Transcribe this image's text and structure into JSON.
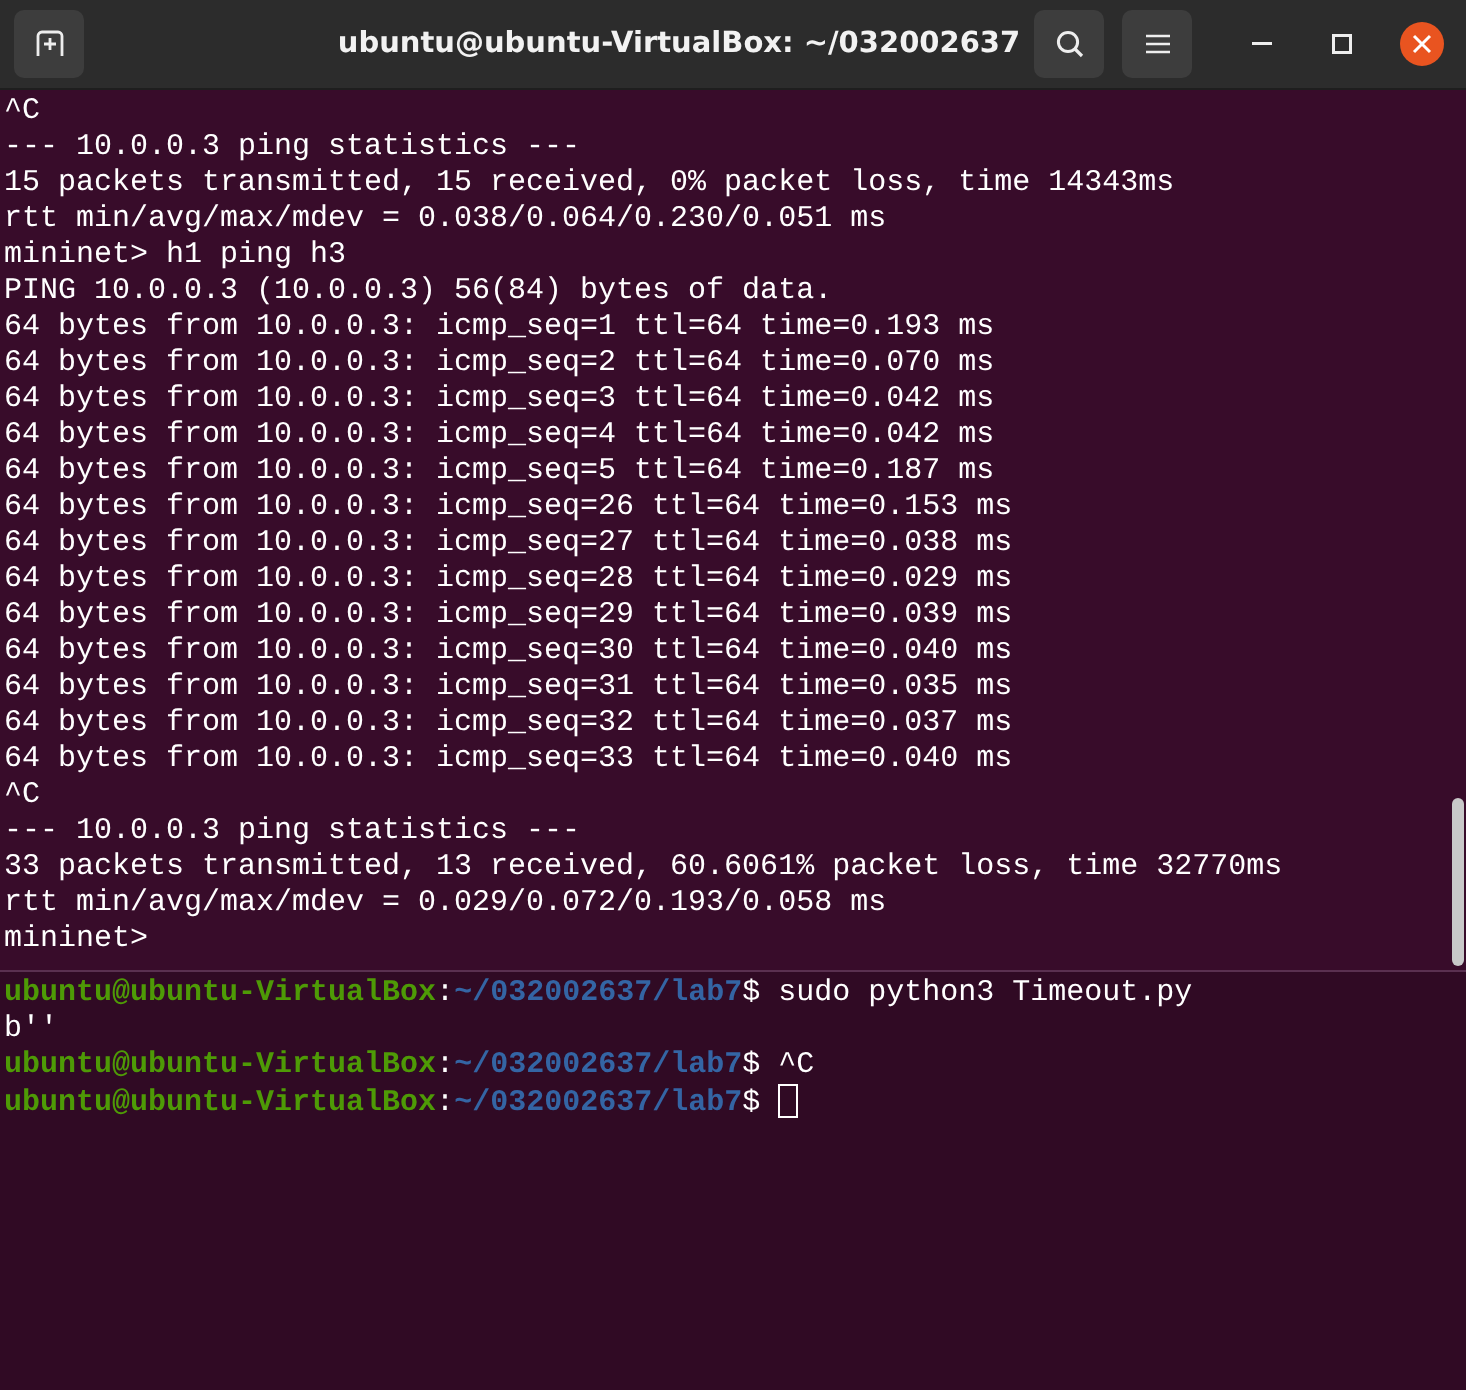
{
  "window": {
    "title": "ubuntu@ubuntu-VirtualBox: ~/032002637"
  },
  "top_pane": {
    "lines": [
      "^C",
      "--- 10.0.0.3 ping statistics ---",
      "15 packets transmitted, 15 received, 0% packet loss, time 14343ms",
      "rtt min/avg/max/mdev = 0.038/0.064/0.230/0.051 ms",
      "mininet> h1 ping h3",
      "PING 10.0.0.3 (10.0.0.3) 56(84) bytes of data.",
      "64 bytes from 10.0.0.3: icmp_seq=1 ttl=64 time=0.193 ms",
      "64 bytes from 10.0.0.3: icmp_seq=2 ttl=64 time=0.070 ms",
      "64 bytes from 10.0.0.3: icmp_seq=3 ttl=64 time=0.042 ms",
      "64 bytes from 10.0.0.3: icmp_seq=4 ttl=64 time=0.042 ms",
      "64 bytes from 10.0.0.3: icmp_seq=5 ttl=64 time=0.187 ms",
      "64 bytes from 10.0.0.3: icmp_seq=26 ttl=64 time=0.153 ms",
      "64 bytes from 10.0.0.3: icmp_seq=27 ttl=64 time=0.038 ms",
      "64 bytes from 10.0.0.3: icmp_seq=28 ttl=64 time=0.029 ms",
      "64 bytes from 10.0.0.3: icmp_seq=29 ttl=64 time=0.039 ms",
      "64 bytes from 10.0.0.3: icmp_seq=30 ttl=64 time=0.040 ms",
      "64 bytes from 10.0.0.3: icmp_seq=31 ttl=64 time=0.035 ms",
      "64 bytes from 10.0.0.3: icmp_seq=32 ttl=64 time=0.037 ms",
      "64 bytes from 10.0.0.3: icmp_seq=33 ttl=64 time=0.040 ms",
      "^C",
      "--- 10.0.0.3 ping statistics ---",
      "33 packets transmitted, 13 received, 60.6061% packet loss, time 32770ms",
      "rtt min/avg/max/mdev = 0.029/0.072/0.193/0.058 ms",
      "mininet>"
    ]
  },
  "bottom_pane": {
    "lines": [
      {
        "kind": "prompt",
        "user": "ubuntu@ubuntu-VirtualBox",
        "colon": ":",
        "path": "~/032002637/lab7",
        "symbol": "$",
        "command": "sudo python3 Timeout.py",
        "cursor": false
      },
      {
        "kind": "output",
        "text": "b''"
      },
      {
        "kind": "prompt",
        "user": "ubuntu@ubuntu-VirtualBox",
        "colon": ":",
        "path": "~/032002637/lab7",
        "symbol": "$",
        "command": "^C",
        "cursor": false
      },
      {
        "kind": "prompt",
        "user": "ubuntu@ubuntu-VirtualBox",
        "colon": ":",
        "path": "~/032002637/lab7",
        "symbol": "$",
        "cursor": true
      }
    ]
  }
}
